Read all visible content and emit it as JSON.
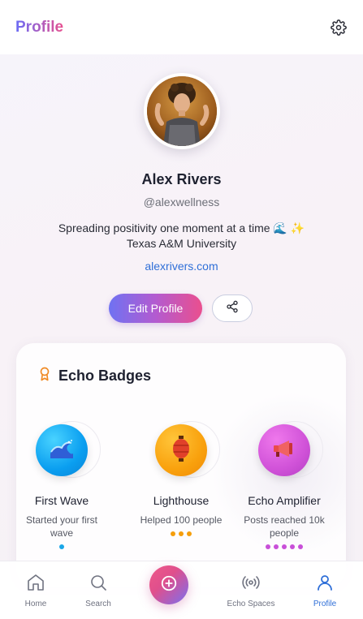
{
  "header": {
    "title": "Profile",
    "settings_icon": "gear-icon"
  },
  "profile": {
    "name": "Alex Rivers",
    "handle": "@alexwellness",
    "bio_line1": "Spreading positivity one moment at a time 🌊 ✨",
    "bio_line2": "Texas A&M University",
    "website": "alexrivers.com",
    "edit_label": "Edit Profile",
    "share_icon": "share-icon"
  },
  "badges_card": {
    "title": "Echo Badges",
    "title_icon": "award-ribbon-icon",
    "badges": [
      {
        "name": "First Wave",
        "desc_line1": "Started your first",
        "desc_line2": "wave",
        "icon": "wave-icon",
        "level": 1,
        "color": "#1aa7e8"
      },
      {
        "name": "Lighthouse",
        "desc_line1": "Helped 100 people",
        "desc_line2": "",
        "icon": "lantern-icon",
        "level": 3,
        "color": "#f59e0b"
      },
      {
        "name": "Echo Amplifier",
        "desc_line1": "Posts reached 10k",
        "desc_line2": "people",
        "icon": "megaphone-icon",
        "level": 5,
        "color": "#c84fd8"
      }
    ]
  },
  "nav": {
    "items": [
      {
        "label": "Home",
        "icon": "home-icon"
      },
      {
        "label": "Search",
        "icon": "search-icon"
      },
      {
        "label": "Echo Spaces",
        "icon": "broadcast-icon"
      },
      {
        "label": "Profile",
        "icon": "user-icon",
        "active": true
      }
    ],
    "create_icon": "plus-circle-icon"
  },
  "colors": {
    "accent_blue": "#2f6fd8",
    "gradient_start": "#6f72f2",
    "gradient_end": "#ea4f8e"
  }
}
